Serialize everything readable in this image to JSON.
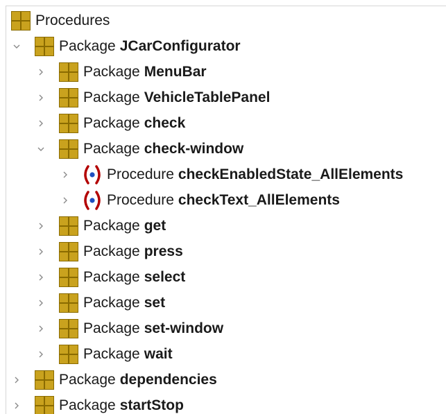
{
  "tree": {
    "root": {
      "label": "Procedures"
    },
    "nodes": [
      {
        "kind": "Package",
        "name": "JCarConfigurator",
        "expanded": true,
        "icon": "package-icon"
      },
      {
        "kind": "Package",
        "name": "MenuBar",
        "expanded": false,
        "icon": "package-icon"
      },
      {
        "kind": "Package",
        "name": "VehicleTablePanel",
        "expanded": false,
        "icon": "package-icon"
      },
      {
        "kind": "Package",
        "name": "check",
        "expanded": false,
        "icon": "package-icon"
      },
      {
        "kind": "Package",
        "name": "check-window",
        "expanded": true,
        "icon": "package-icon"
      },
      {
        "kind": "Procedure",
        "name": "checkEnabledState_AllElements",
        "expanded": false,
        "icon": "procedure-icon"
      },
      {
        "kind": "Procedure",
        "name": "checkText_AllElements",
        "expanded": false,
        "icon": "procedure-icon"
      },
      {
        "kind": "Package",
        "name": "get",
        "expanded": false,
        "icon": "package-icon"
      },
      {
        "kind": "Package",
        "name": "press",
        "expanded": false,
        "icon": "package-icon"
      },
      {
        "kind": "Package",
        "name": "select",
        "expanded": false,
        "icon": "package-icon"
      },
      {
        "kind": "Package",
        "name": "set",
        "expanded": false,
        "icon": "package-icon"
      },
      {
        "kind": "Package",
        "name": "set-window",
        "expanded": false,
        "icon": "package-icon"
      },
      {
        "kind": "Package",
        "name": "wait",
        "expanded": false,
        "icon": "package-icon"
      },
      {
        "kind": "Package",
        "name": "dependencies",
        "expanded": false,
        "icon": "package-icon"
      },
      {
        "kind": "Package",
        "name": "startStop",
        "expanded": false,
        "icon": "package-icon"
      }
    ]
  },
  "colors": {
    "package_fill": "#c9a21e",
    "package_border": "#8a6b00",
    "procedure_paren": "#b30000",
    "procedure_dot": "#1f4fbf",
    "chevron": "#8a8a8a"
  }
}
